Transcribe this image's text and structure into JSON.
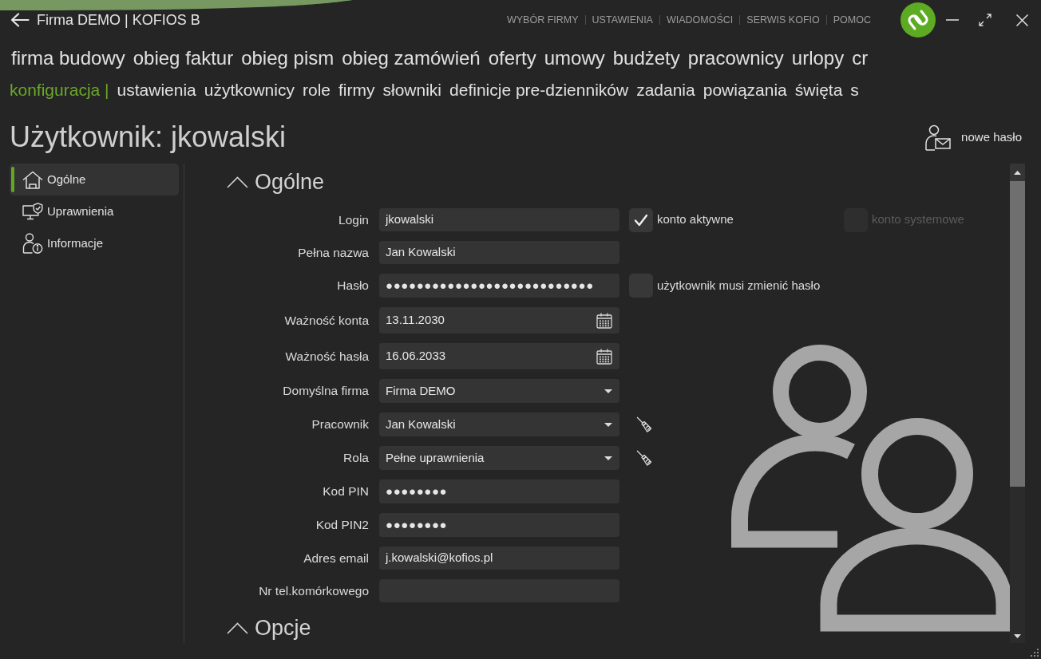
{
  "window": {
    "title": "Firma DEMO | KOFIOS B"
  },
  "top_links": [
    "WYBÓR FIRMY",
    "USTAWIENIA",
    "WIADOMOŚCI",
    "SERWIS KOFIO",
    "POMOC"
  ],
  "main_menu": [
    "firma budowy",
    "obieg faktur",
    "obieg pism",
    "obieg zamówień",
    "oferty",
    "umowy",
    "budżety",
    "pracownicy",
    "urlopy",
    "cr"
  ],
  "sub_menu": {
    "section": "konfiguracja |",
    "items": [
      "ustawienia",
      "użytkownicy",
      "role",
      "firmy",
      "słowniki",
      "definicje pre-dzienników",
      "zadania",
      "powiązania",
      "święta",
      "s"
    ]
  },
  "page_title": "Użytkownik: jkowalski",
  "actions": [
    {
      "label": "nowe hasło"
    }
  ],
  "sidebar": {
    "items": [
      {
        "label": "Ogólne",
        "selected": true
      },
      {
        "label": "Uprawnienia",
        "selected": false
      },
      {
        "label": "Informacje",
        "selected": false
      }
    ]
  },
  "sections": [
    {
      "title": "Ogólne",
      "expanded": true,
      "fields": [
        {
          "label": "Login",
          "kind": "text",
          "value": "jkowalski",
          "checkboxes": [
            {
              "label": "konto aktywne",
              "checked": true,
              "disabled": false
            },
            {
              "label": "konto systemowe",
              "checked": false,
              "disabled": true
            }
          ]
        },
        {
          "label": "Pełna nazwa",
          "kind": "text",
          "value": "Jan Kowalski"
        },
        {
          "label": "Hasło",
          "kind": "password",
          "value": "●●●●●●●●●●●●●●●●●●●●●●●●●●●",
          "checkboxes": [
            {
              "label": "użytkownik musi zmienić hasło",
              "checked": false,
              "disabled": false
            }
          ]
        },
        {
          "label": "Ważność konta",
          "kind": "date",
          "value": "13.11.2030"
        },
        {
          "label": "Ważność hasła",
          "kind": "date",
          "value": "16.06.2033"
        },
        {
          "label": "Domyślna firma",
          "kind": "select",
          "value": "Firma DEMO"
        },
        {
          "label": "Pracownik",
          "kind": "select",
          "value": "Jan Kowalski",
          "clear_button": true
        },
        {
          "label": "Rola",
          "kind": "select",
          "value": "Pełne uprawnienia",
          "clear_button": true
        },
        {
          "label": "Kod PIN",
          "kind": "password",
          "value": "●●●●●●●●"
        },
        {
          "label": "Kod PIN2",
          "kind": "password",
          "value": "●●●●●●●●"
        },
        {
          "label": "Adres email",
          "kind": "text",
          "value": "j.kowalski@kofios.pl"
        },
        {
          "label": "Nr tel.komórkowego",
          "kind": "text"
        }
      ]
    },
    {
      "title": "Opcje",
      "expanded": true
    }
  ]
}
